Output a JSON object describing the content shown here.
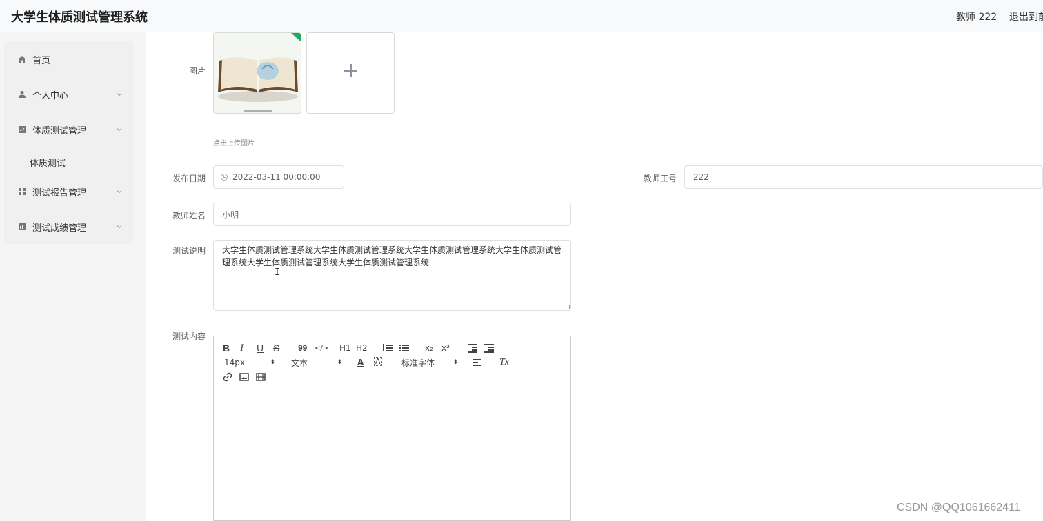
{
  "header": {
    "app_title": "大学生体质测试管理系统",
    "user_label": "教师 222",
    "logout_label": "退出到前台"
  },
  "sidebar": {
    "items": [
      {
        "label": "首页",
        "icon": "home-icon"
      },
      {
        "label": "个人中心",
        "icon": "user-icon"
      },
      {
        "label": "体质测试管理",
        "icon": "chart-icon"
      },
      {
        "label": "测试报告管理",
        "icon": "grid-icon"
      },
      {
        "label": "测试成绩管理",
        "icon": "bar-chart-icon"
      }
    ],
    "submenu": {
      "label": "体质测试"
    }
  },
  "form": {
    "image_label": "图片",
    "upload_tip": "点击上传图片",
    "publish_date_label": "发布日期",
    "publish_date_value": "2022-03-11 00:00:00",
    "teacher_no_label": "教师工号",
    "teacher_no_value": "222",
    "teacher_name_label": "教师姓名",
    "teacher_name_value": "小明",
    "test_desc_label": "测试说明",
    "test_desc_value": "大学生体质测试管理系统大学生体质测试管理系统大学生体质测试管理系统大学生体质测试管理系统大学生体质测试管理系统大学生体质测试管理系统",
    "test_content_label": "测试内容"
  },
  "editor": {
    "font_size": "14px",
    "heading": "文本",
    "font_family": "标准字体",
    "h1": "H1",
    "h2": "H2",
    "bold": "B",
    "italic": "I",
    "underline": "U",
    "strike": "S",
    "quote": "99",
    "code": "</>",
    "sub": "x₂",
    "sup": "x²",
    "clean": "Tx"
  },
  "watermark": "CSDN @QQ1061662411"
}
